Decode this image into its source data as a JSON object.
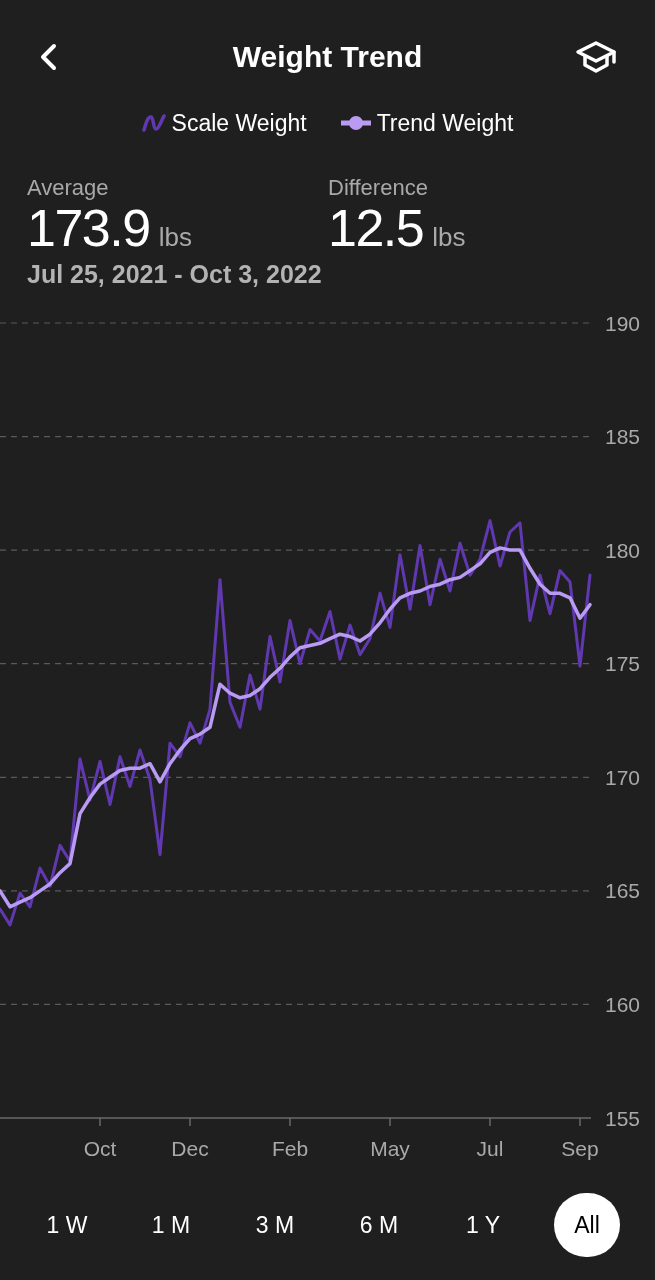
{
  "header": {
    "title": "Weight Trend"
  },
  "legend": [
    {
      "kind": "raw"
    },
    {
      "kind": "trend"
    }
  ],
  "stats": [
    {
      "label": "Average",
      "value": "173.9",
      "unit": "lbs"
    },
    {
      "label": "Difference",
      "value": "12.5",
      "unit": "lbs"
    }
  ],
  "date_range": "Jul 25, 2021 - Oct 3, 2022",
  "chart": {
    "chart_data": {
      "type": "line",
      "grid": true,
      "categories": [
        null,
        null,
        null,
        null,
        null,
        null,
        null,
        null,
        null,
        null,
        "Oct",
        null,
        null,
        null,
        null,
        null,
        null,
        null,
        null,
        "Dec",
        null,
        null,
        null,
        null,
        null,
        null,
        null,
        null,
        null,
        "Feb",
        null,
        null,
        null,
        null,
        null,
        null,
        null,
        null,
        null,
        "May",
        null,
        null,
        null,
        null,
        null,
        null,
        null,
        null,
        null,
        "Jul",
        null,
        null,
        null,
        null,
        null,
        null,
        null,
        null,
        "Sep",
        null
      ],
      "ylim": [
        155,
        190
      ],
      "yticks": [
        155,
        160,
        165,
        170,
        175,
        180,
        185,
        190
      ],
      "series": [
        {
          "name": "Scale Weight",
          "color": "#6039b0",
          "values": [
            164.2,
            163.5,
            164.9,
            164.3,
            166.0,
            165.2,
            167.0,
            166.3,
            170.8,
            169.0,
            170.7,
            168.8,
            170.9,
            169.6,
            171.2,
            169.9,
            166.6,
            171.5,
            170.9,
            172.4,
            171.5,
            173.0,
            178.7,
            173.3,
            172.2,
            174.5,
            173.0,
            176.2,
            174.2,
            176.9,
            175.0,
            176.5,
            176.0,
            177.3,
            175.2,
            176.7,
            175.4,
            176.1,
            178.1,
            176.6,
            179.8,
            177.4,
            180.2,
            177.6,
            179.6,
            178.2,
            180.3,
            178.9,
            179.6,
            181.3,
            179.3,
            180.8,
            181.2,
            176.9,
            178.9,
            177.2,
            179.1,
            178.6,
            174.9,
            178.9
          ]
        },
        {
          "name": "Trend Weight",
          "color": "#b99bf3",
          "values": [
            165.0,
            164.3,
            164.5,
            164.7,
            165.0,
            165.3,
            165.8,
            166.2,
            168.4,
            169.1,
            169.7,
            170.0,
            170.3,
            170.4,
            170.4,
            170.6,
            169.8,
            170.6,
            171.2,
            171.7,
            171.9,
            172.2,
            174.1,
            173.7,
            173.5,
            173.6,
            173.9,
            174.4,
            174.8,
            175.3,
            175.7,
            175.8,
            175.9,
            176.1,
            176.3,
            176.2,
            176.0,
            176.3,
            176.8,
            177.4,
            177.9,
            178.1,
            178.2,
            178.4,
            178.5,
            178.7,
            178.8,
            179.1,
            179.4,
            179.9,
            180.1,
            180.0,
            180.0,
            179.2,
            178.5,
            178.1,
            178.1,
            177.9,
            177.0,
            177.6
          ]
        }
      ]
    }
  },
  "ranges": [
    {
      "label": "1 W",
      "selected": false
    },
    {
      "label": "1 M",
      "selected": false
    },
    {
      "label": "3 M",
      "selected": false
    },
    {
      "label": "6 M",
      "selected": false
    },
    {
      "label": "1 Y",
      "selected": false
    },
    {
      "label": "All",
      "selected": true
    }
  ]
}
